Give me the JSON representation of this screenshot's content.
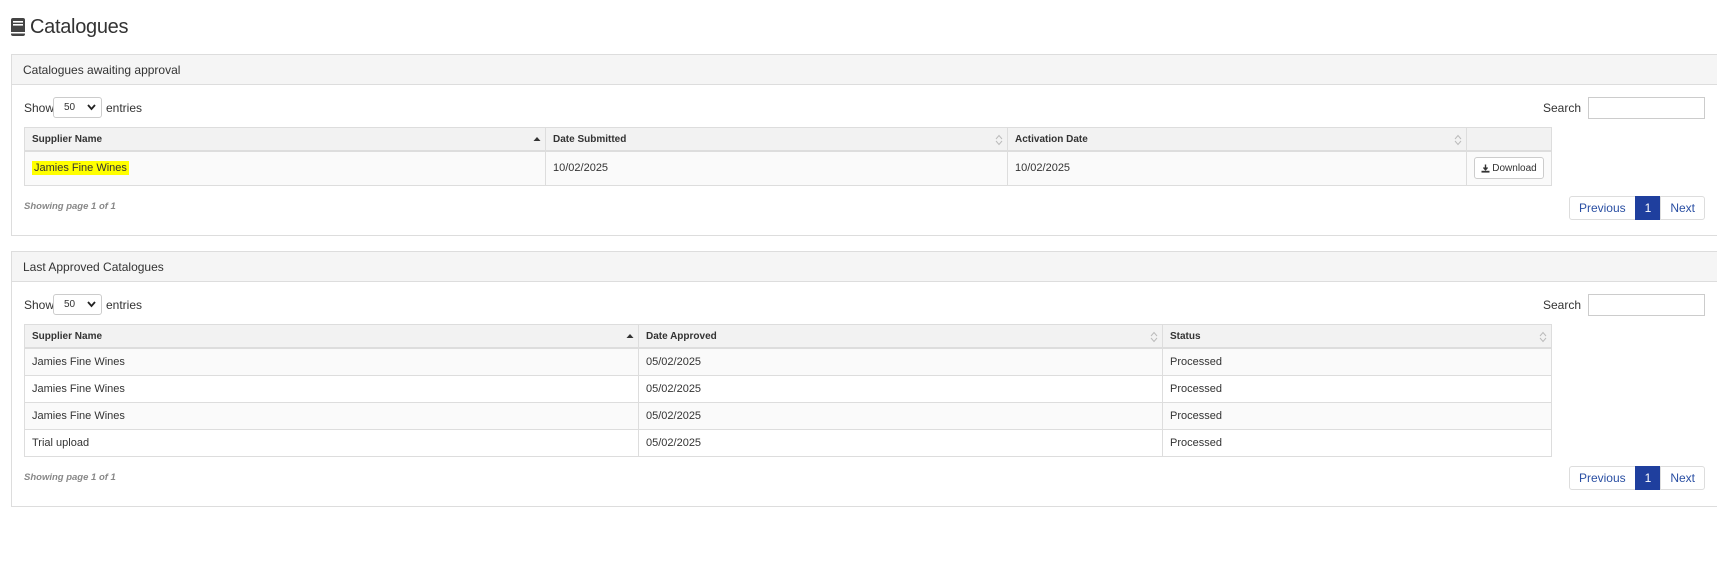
{
  "page": {
    "title": "Catalogues",
    "icon": "book-icon"
  },
  "awaiting": {
    "heading": "Catalogues awaiting approval",
    "show_label": "Show",
    "entries_value": "50",
    "entries_label": "entries",
    "search_label": "Search",
    "search_value": "",
    "columns": [
      "Supplier Name",
      "Date Submitted",
      "Activation Date",
      ""
    ],
    "rows": [
      {
        "supplier": "Jamies Fine Wines",
        "date_submitted": "10/02/2025",
        "activation_date": "10/02/2025",
        "action_label": "Download"
      }
    ],
    "footer": "Showing page 1 of 1",
    "pager": {
      "previous": "Previous",
      "current": "1",
      "next": "Next"
    }
  },
  "approved": {
    "heading": "Last Approved Catalogues",
    "show_label": "Show",
    "entries_value": "50",
    "entries_label": "entries",
    "search_label": "Search",
    "search_value": "",
    "columns": [
      "Supplier Name",
      "Date Approved",
      "Status"
    ],
    "rows": [
      {
        "supplier": "Jamies Fine Wines",
        "date_approved": "05/02/2025",
        "status": "Processed"
      },
      {
        "supplier": "Jamies Fine Wines",
        "date_approved": "05/02/2025",
        "status": "Processed"
      },
      {
        "supplier": "Jamies Fine Wines",
        "date_approved": "05/02/2025",
        "status": "Processed"
      },
      {
        "supplier": "Trial upload",
        "date_approved": "05/02/2025",
        "status": "Processed"
      }
    ],
    "footer": "Showing page 1 of 1",
    "pager": {
      "previous": "Previous",
      "current": "1",
      "next": "Next"
    }
  },
  "colors": {
    "accent": "#1f3f9e",
    "highlight": "#ffff00",
    "panel_heading_bg": "#f5f5f5",
    "border": "#dddddd"
  }
}
